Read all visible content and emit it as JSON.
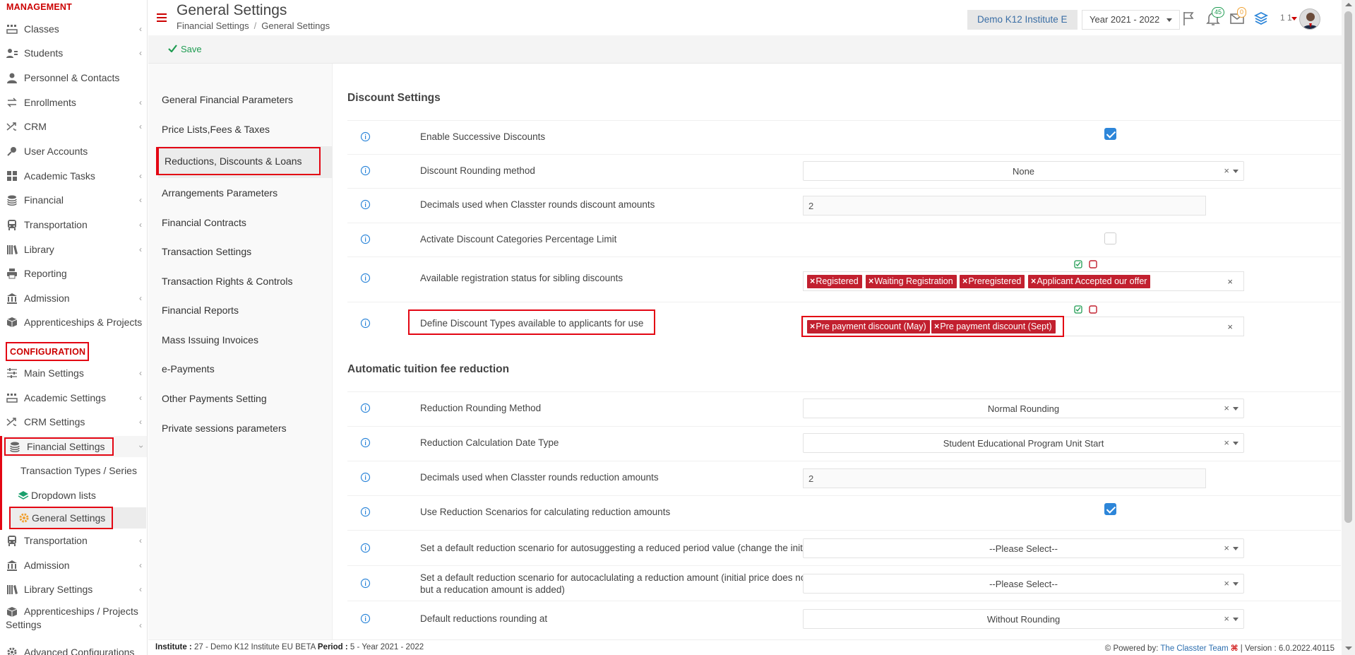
{
  "sidebar": {
    "management_title": "MANAGEMENT",
    "management_items": [
      {
        "label": "Classes",
        "icon": "classes-icon"
      },
      {
        "label": "Students",
        "icon": "students-icon"
      },
      {
        "label": "Personnel & Contacts",
        "icon": "personnel-icon"
      },
      {
        "label": "Enrollments",
        "icon": "enrollments-icon"
      },
      {
        "label": "CRM",
        "icon": "crm-icon"
      },
      {
        "label": "User Accounts",
        "icon": "key-icon"
      },
      {
        "label": "Academic Tasks",
        "icon": "tasks-icon"
      },
      {
        "label": "Financial",
        "icon": "financial-icon"
      },
      {
        "label": "Transportation",
        "icon": "bus-icon"
      },
      {
        "label": "Library",
        "icon": "library-icon"
      },
      {
        "label": "Reporting",
        "icon": "printer-icon"
      },
      {
        "label": "Admission",
        "icon": "bank-icon"
      },
      {
        "label": "Apprenticeships & Projects",
        "icon": "box-icon"
      }
    ],
    "configuration_title": "CONFIGURATION",
    "configuration_items": [
      {
        "label": "Main Settings",
        "icon": "sliders-icon"
      },
      {
        "label": "Academic Settings",
        "icon": "classes-icon"
      },
      {
        "label": "CRM Settings",
        "icon": "crm-icon"
      },
      {
        "label": "Financial Settings",
        "icon": "financial-icon"
      },
      {
        "label": "Transaction Types / Series",
        "icon": ""
      },
      {
        "label": "Dropdown lists",
        "icon": "layers-icon"
      },
      {
        "label": "General Settings",
        "icon": "gear-icon"
      },
      {
        "label": "Transportation",
        "icon": "bus-icon"
      },
      {
        "label": "Admission",
        "icon": "bank-icon"
      },
      {
        "label": "Library Settings",
        "icon": "library-icon"
      },
      {
        "label_line1": "Apprenticeships / Projects",
        "label_line2": "Settings",
        "icon": "box-icon"
      },
      {
        "label": "Advanced Configurations",
        "icon": "gear-icon"
      }
    ]
  },
  "header": {
    "title": "General Settings",
    "breadcrumb": [
      "Financial Settings",
      "General Settings"
    ],
    "breadcrumb_sep": "/",
    "institute": "Demo K12 Institute E",
    "year": "Year 2021 - 2022",
    "notifications_count": "45",
    "messages_count": "0",
    "user_label": "1 1"
  },
  "toolbar": {
    "save_label": "Save"
  },
  "settings_nav": [
    "General Financial Parameters",
    "Price Lists,Fees & Taxes",
    "Reductions, Discounts & Loans",
    "Arrangements Parameters",
    "Financial Contracts",
    "Transaction Settings",
    "Transaction Rights & Controls",
    "Financial Reports",
    "Mass Issuing Invoices",
    "e-Payments",
    "Other Payments Setting",
    "Private sessions parameters"
  ],
  "discount": {
    "title": "Discount Settings",
    "enable_successive_label": "Enable Successive Discounts",
    "enable_successive_checked": true,
    "rounding_label": "Discount Rounding method",
    "rounding_value": "None",
    "decimals_label": "Decimals used when Classter rounds discount amounts",
    "decimals_value": "2",
    "categories_limit_label": "Activate Discount Categories Percentage Limit",
    "categories_limit_checked": false,
    "sibling_label": "Available registration status for sibling discounts",
    "sibling_tags": [
      "Registered",
      "Waiting Registration",
      "Preregistered",
      "Applicant Accepted our offer"
    ],
    "types_label": "Define Discount Types available to applicants for use",
    "types_tags": [
      "Pre payment discount (May)",
      "Pre payment discount (Sept)"
    ]
  },
  "reduction": {
    "title": "Automatic tuition fee reduction",
    "rounding_label": "Reduction Rounding Method",
    "rounding_value": "Normal Rounding",
    "date_type_label": "Reduction Calculation Date Type",
    "date_type_value": "Student Educational Program Unit Start",
    "decimals_label": "Decimals used when Classter rounds reduction amounts",
    "decimals_value": "2",
    "scenarios_label": "Use Reduction Scenarios for calculating reduction amounts",
    "scenarios_checked": true,
    "default_period_label": "Set a default reduction scenario for autosuggesting a reduced period value (change the initial price)",
    "default_period_value": "--Please Select--",
    "default_amount_label_line1": "Set a default reduction scenario for autocaclulating a reduction amount (initial price does not change,",
    "default_amount_label_line2": "but a reducation amount is added)",
    "default_amount_value": "--Please Select--",
    "rounding_at_label": "Default reductions rounding at",
    "rounding_at_value": "Without Rounding"
  },
  "footer": {
    "institute_label": "Institute :",
    "institute_value": "27 - Demo K12 Institute EU BETA",
    "period_label": "Period :",
    "period_value": "5 - Year 2021 - 2022",
    "powered_by": "Powered by:",
    "powered_link": "The Classter Team",
    "version": "| Version : 6.0.2022.40115"
  },
  "colors": {
    "accent_red": "#e30613",
    "tag_red": "#c2202f",
    "link_blue": "#2d6fb0",
    "check_blue": "#2d86d9",
    "save_green": "#1f9c52"
  }
}
